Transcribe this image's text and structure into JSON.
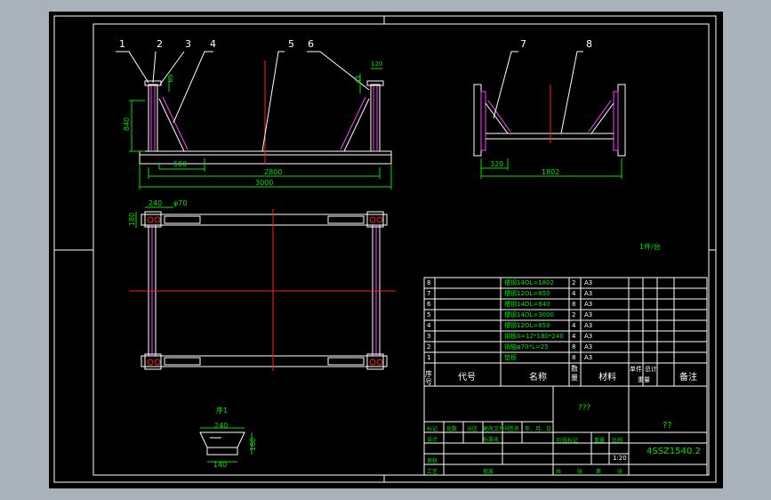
{
  "balloons": [
    "1",
    "2",
    "3",
    "4",
    "5",
    "6",
    "7",
    "8"
  ],
  "front_view": {
    "dim_840": "840",
    "dim_60": "60",
    "dim_120": "120",
    "dim_45": "45",
    "dim_500": "500",
    "dim_2800": "2800",
    "dim_3000": "3000"
  },
  "side_view": {
    "dim_320": "320",
    "dim_1802": "1802"
  },
  "plan_view": {
    "dim_240": "240",
    "dim_phi": "φ70",
    "dim_180": "180"
  },
  "detail": {
    "title": "序1",
    "dim_240": "240",
    "dim_160": "160",
    "dim_140": "140"
  },
  "note": "1件/台",
  "bom": {
    "rows": [
      {
        "no": "8",
        "name": "槽钢14OL=1802",
        "qty": "2",
        "mat": "A3"
      },
      {
        "no": "7",
        "name": "槽钢12OL=850",
        "qty": "4",
        "mat": "A3"
      },
      {
        "no": "6",
        "name": "槽钢14OL=840",
        "qty": "8",
        "mat": "A3"
      },
      {
        "no": "5",
        "name": "槽钢14OL=3000",
        "qty": "2",
        "mat": "A3"
      },
      {
        "no": "4",
        "name": "槽钢12OL=850",
        "qty": "4",
        "mat": "A3"
      },
      {
        "no": "3",
        "name": "钢板δ=12*180*240",
        "qty": "4",
        "mat": "A3"
      },
      {
        "no": "2",
        "name": "销轴φ70*L=25",
        "qty": "8",
        "mat": "A3"
      },
      {
        "no": "1",
        "name": "垫板",
        "qty": "8",
        "mat": "A3"
      }
    ],
    "header": {
      "no": "序号",
      "code": "代号",
      "name": "名称",
      "qty": "数量",
      "mat": "材料",
      "unit_weight": "单件",
      "total_weight": "总计",
      "weight": "重量",
      "remarks": "备注"
    }
  },
  "title_block": {
    "company": "???",
    "drawing_title": "??",
    "drawing_no": "4SSZ1540.2",
    "scale": "1:20",
    "labels": {
      "mark": "标记",
      "count": "处数",
      "zone": "分区",
      "change_doc": "更改文件号",
      "sign": "签名",
      "date": "年、月、日",
      "design": "设计",
      "standardize": "标准化",
      "stage_mark": "阶段标记",
      "weight": "重量",
      "ratio": "比例",
      "review": "审核",
      "process": "工艺",
      "approve": "批准",
      "sheets_total": "共",
      "sheet_unit": "张",
      "sheet_no": "第",
      "sheet_unit2": "张"
    }
  }
}
